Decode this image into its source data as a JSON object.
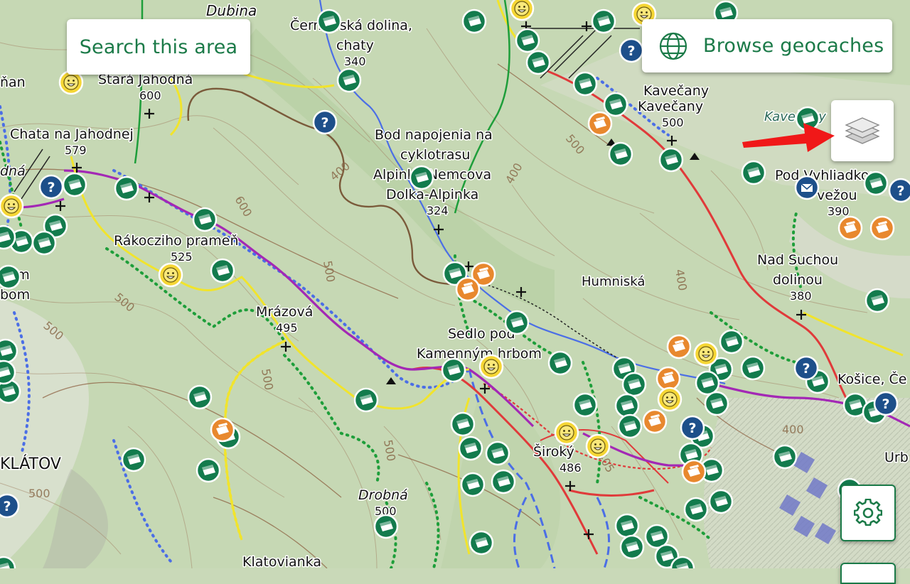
{
  "toolbar": {
    "search_area_label": "Search this area",
    "browse_geocaches_label": "Browse geocaches"
  },
  "colors": {
    "accent": "#1b7a48",
    "cache_traditional": "#137b4d",
    "cache_multi": "#e8882e",
    "cache_event": "#f5d635",
    "cache_unknown": "#1d4f8a",
    "trail_red": "#e03a3a",
    "trail_blue": "#4b6ee6",
    "trail_green": "#1e9e3a",
    "trail_yellow": "#f1e42c",
    "trail_purple": "#a328b5"
  },
  "map_labels": [
    {
      "text": "Dubina"
    },
    {
      "text": "Čermeľská dolina,"
    },
    {
      "text": "chaty"
    },
    {
      "text": "340"
    },
    {
      "text": "Stará Jahodná"
    },
    {
      "text": "600"
    },
    {
      "text": "Chata na Jahodnej"
    },
    {
      "text": "579"
    },
    {
      "text": "Bod napojenia na"
    },
    {
      "text": "cyklotrasu"
    },
    {
      "text": "Alpinka-Nemcova"
    },
    {
      "text": "Dolka-Alpinka"
    },
    {
      "text": "324"
    },
    {
      "text": "Kavečany"
    },
    {
      "text": "Kavečany"
    },
    {
      "text": "500"
    },
    {
      "text": "Kavečany"
    },
    {
      "text": "Pod Vyhliadkou"
    },
    {
      "text": "vežou"
    },
    {
      "text": "390"
    },
    {
      "text": "Rákocziho prameň"
    },
    {
      "text": "525"
    },
    {
      "text": "Humniská"
    },
    {
      "text": "Nad Suchou"
    },
    {
      "text": "dolinou"
    },
    {
      "text": "380"
    },
    {
      "text": "Mrázová"
    },
    {
      "text": "495"
    },
    {
      "text": "Sedlo pod"
    },
    {
      "text": "Kamenným hrbom"
    },
    {
      "text": "Široký"
    },
    {
      "text": "486"
    },
    {
      "text": "Drobná"
    },
    {
      "text": "500"
    },
    {
      "text": "Klatovianka"
    },
    {
      "text": "KLÁTOV"
    },
    {
      "text": "Košice, Če"
    },
    {
      "text": "Urb"
    },
    {
      "text": "ným"
    },
    {
      "text": "bom"
    },
    {
      "text": "ňan"
    },
    {
      "text": "dná"
    }
  ],
  "geocaches": {
    "traditional": 84,
    "multi": 14,
    "event": 12,
    "unknown": 9,
    "letterbox": 1
  }
}
